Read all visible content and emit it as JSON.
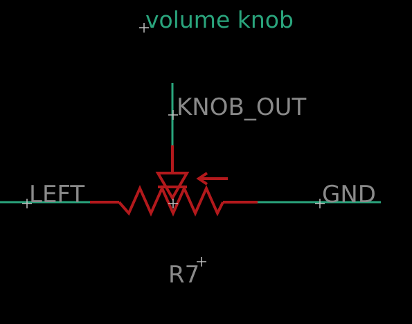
{
  "component_value": "volume knob",
  "component_name": "R7",
  "nets": {
    "wiper": "KNOB_OUT",
    "left_pin": "LEFT",
    "right_pin": "GND"
  },
  "colors": {
    "background": "#000000",
    "wire": "#2aa57d",
    "symbol": "#b3191c",
    "net_label": "#8a8a8a",
    "value_label": "#2aa57d",
    "origin_cross": "#bfbfbf"
  },
  "symbol_type": "potentiometer-icon"
}
